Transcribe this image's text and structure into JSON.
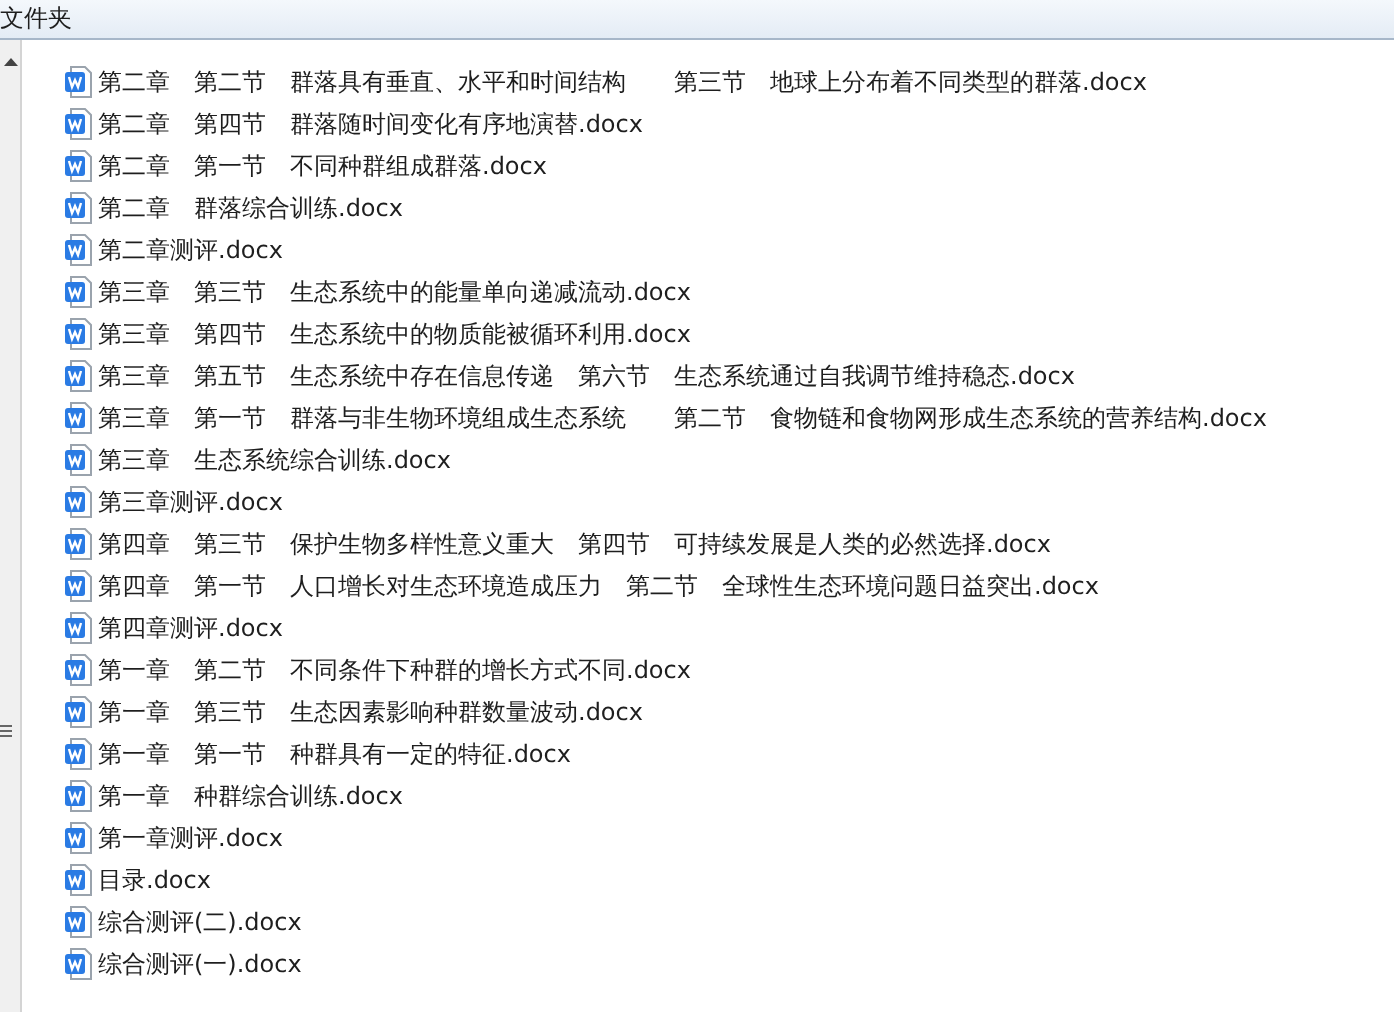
{
  "header": {
    "title": "文件夹"
  },
  "files": [
    {
      "name": "第二章　第二节　群落具有垂直、水平和时间结构　　第三节　地球上分布着不同类型的群落.docx"
    },
    {
      "name": "第二章　第四节　群落随时间变化有序地演替.docx"
    },
    {
      "name": "第二章　第一节　不同种群组成群落.docx"
    },
    {
      "name": "第二章　群落综合训练.docx"
    },
    {
      "name": "第二章测评.docx"
    },
    {
      "name": "第三章　第三节　生态系统中的能量单向递减流动.docx"
    },
    {
      "name": "第三章　第四节　生态系统中的物质能被循环利用.docx"
    },
    {
      "name": "第三章　第五节　生态系统中存在信息传递　第六节　生态系统通过自我调节维持稳态.docx"
    },
    {
      "name": "第三章　第一节　群落与非生物环境组成生态系统　　第二节　食物链和食物网形成生态系统的营养结构.docx"
    },
    {
      "name": "第三章　生态系统综合训练.docx"
    },
    {
      "name": "第三章测评.docx"
    },
    {
      "name": "第四章　第三节　保护生物多样性意义重大　第四节　可持续发展是人类的必然选择.docx"
    },
    {
      "name": "第四章　第一节　人口增长对生态环境造成压力　第二节　全球性生态环境问题日益突出.docx"
    },
    {
      "name": "第四章测评.docx"
    },
    {
      "name": "第一章　第二节　不同条件下种群的增长方式不同.docx"
    },
    {
      "name": "第一章　第三节　生态因素影响种群数量波动.docx"
    },
    {
      "name": "第一章　第一节　种群具有一定的特征.docx"
    },
    {
      "name": "第一章　种群综合训练.docx"
    },
    {
      "name": "第一章测评.docx"
    },
    {
      "name": "目录.docx"
    },
    {
      "name": "综合测评(二).docx"
    },
    {
      "name": "综合测评(一).docx"
    }
  ]
}
